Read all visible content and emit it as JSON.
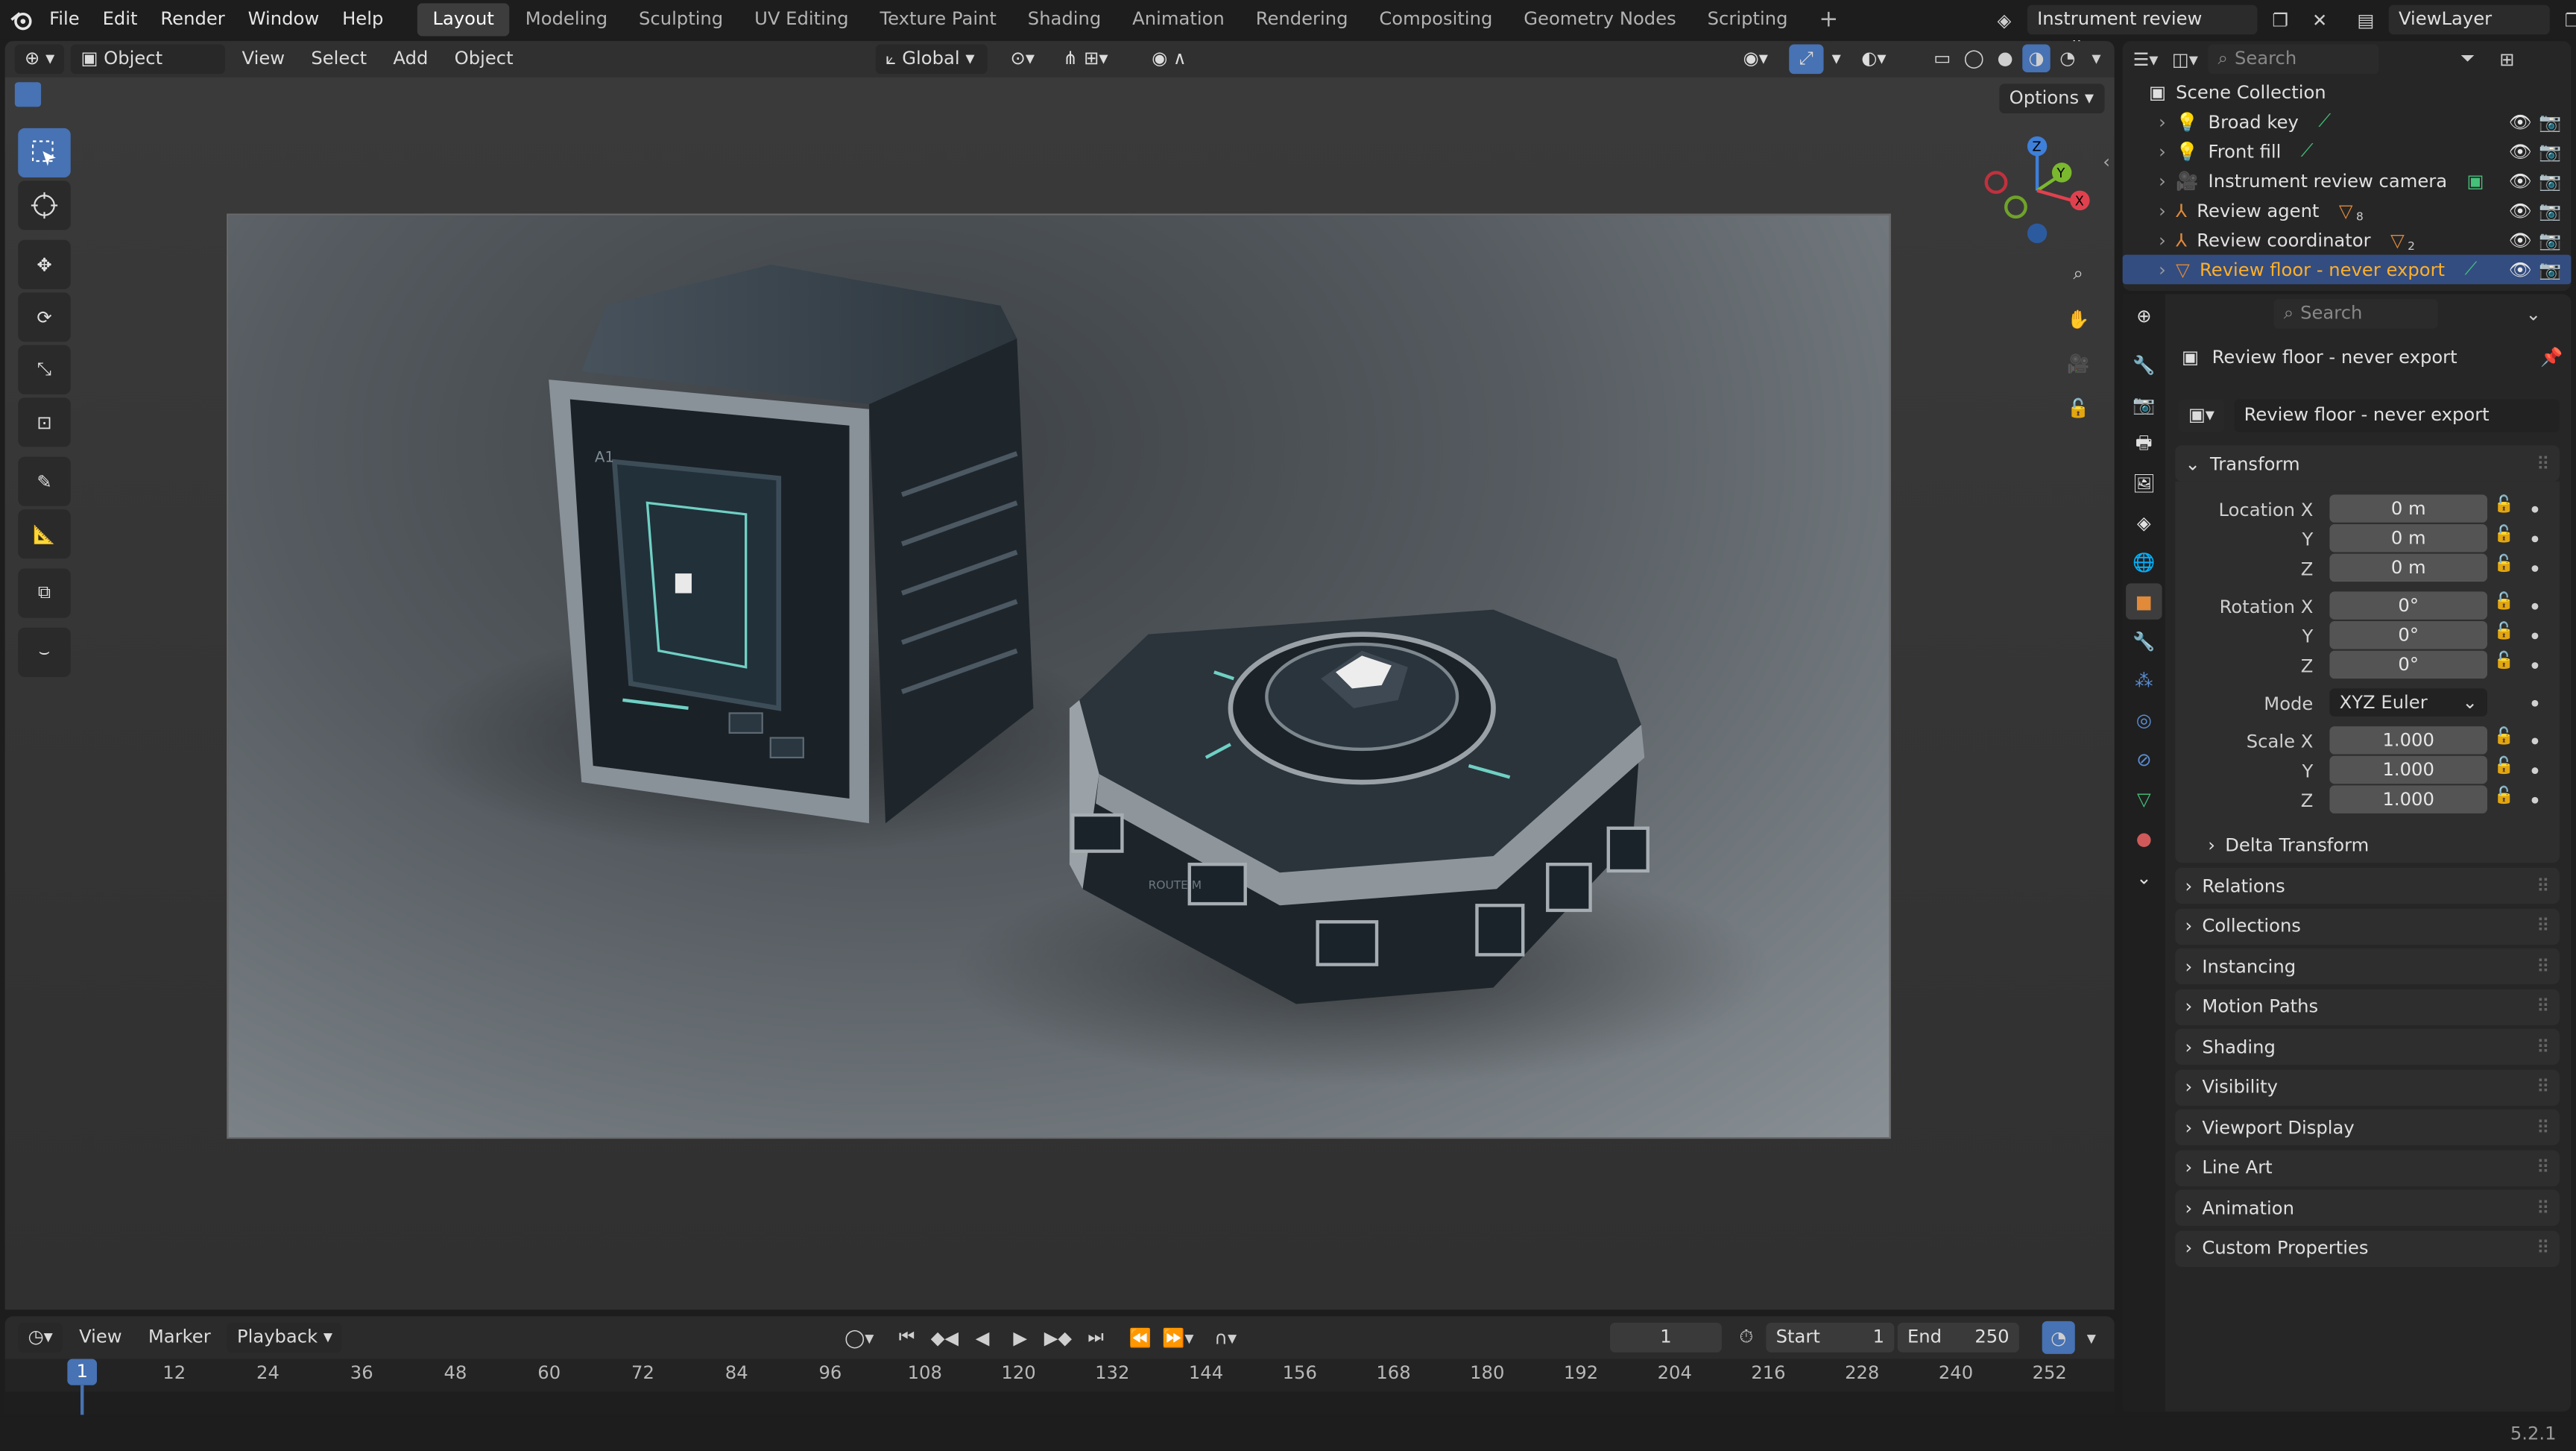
{
  "topbar": {
    "menus": [
      "File",
      "Edit",
      "Render",
      "Window",
      "Help"
    ],
    "workspaces": [
      "Layout",
      "Modeling",
      "Sculpting",
      "UV Editing",
      "Texture Paint",
      "Shading",
      "Animation",
      "Rendering",
      "Compositing",
      "Geometry Nodes",
      "Scripting"
    ],
    "active_workspace": "Layout",
    "scene_name": "Instrument review studio",
    "view_layer": "ViewLayer"
  },
  "viewport_header": {
    "mode": "Object Mode",
    "menus": [
      "View",
      "Select",
      "Add",
      "Object"
    ],
    "orientation": "Global",
    "options_label": "Options"
  },
  "outliner": {
    "search_placeholder": "Search",
    "collection": "Scene Collection",
    "items": [
      {
        "label": "Broad key",
        "type": "light"
      },
      {
        "label": "Front fill",
        "type": "light"
      },
      {
        "label": "Instrument review camera",
        "type": "camera"
      },
      {
        "label": "Review agent",
        "type": "armature",
        "badge": "8"
      },
      {
        "label": "Review coordinator",
        "type": "armature",
        "badge": "2"
      },
      {
        "label": "Review floor - never export",
        "type": "mesh",
        "selected": true
      }
    ]
  },
  "properties": {
    "search_placeholder": "Search",
    "object_name": "Review floor - never export",
    "datablock_name": "Review floor - never export",
    "transform_label": "Transform",
    "location_label": "Location X",
    "rotation_label": "Rotation X",
    "scale_label": "Scale X",
    "mode_label": "Mode",
    "axis_y": "Y",
    "axis_z": "Z",
    "location": [
      "0 m",
      "0 m",
      "0 m"
    ],
    "rotation": [
      "0°",
      "0°",
      "0°"
    ],
    "rotation_mode": "XYZ Euler",
    "scale": [
      "1.000",
      "1.000",
      "1.000"
    ],
    "delta_label": "Delta Transform",
    "panels": [
      "Relations",
      "Collections",
      "Instancing",
      "Motion Paths",
      "Shading",
      "Visibility",
      "Viewport Display",
      "Line Art",
      "Animation",
      "Custom Properties"
    ]
  },
  "timeline": {
    "menus": [
      "View",
      "Marker",
      "Playback"
    ],
    "current_frame": "1",
    "start_label": "Start",
    "start": "1",
    "end_label": "End",
    "end": "250",
    "ticks": [
      "12",
      "24",
      "36",
      "48",
      "60",
      "72",
      "84",
      "96",
      "108",
      "120",
      "132",
      "144",
      "156",
      "168",
      "180",
      "192",
      "204",
      "216",
      "228",
      "240",
      "252"
    ],
    "playhead": "1"
  },
  "status": {
    "version": "5.2.1"
  },
  "scene": {
    "box_label_1": "A1",
    "box_label_2": "ROUTE M"
  },
  "colors": {
    "accent": "#4772b3",
    "selected_row": "#334d80",
    "highlight_text": "#ffaf29",
    "light_icon": "#e0a030",
    "mesh_icon": "#e08a3a"
  }
}
